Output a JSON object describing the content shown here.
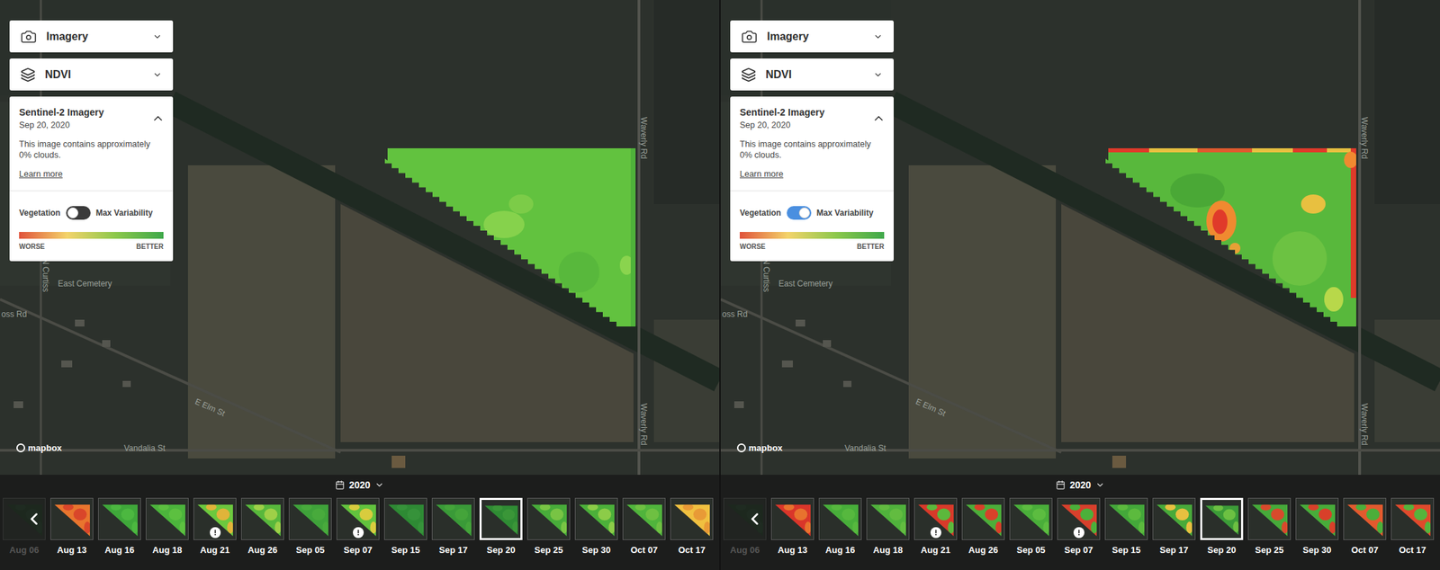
{
  "panels": [
    {
      "imagery_dropdown": {
        "label": "Imagery"
      },
      "layer_dropdown": {
        "label": "NDVI"
      },
      "card": {
        "title": "Sentinel-2 Imagery",
        "date": "Sep 20, 2020",
        "description": "This image contains approximately 0% clouds.",
        "link": "Learn more",
        "expanded": true,
        "toggle": {
          "left_label": "Vegetation",
          "right_label": "Max Variability",
          "on": false
        },
        "legend": {
          "low": "WORSE",
          "high": "BETTER"
        }
      },
      "map_labels": [
        {
          "text": "Waverly Rd",
          "kind": "vertical"
        },
        {
          "text": "Waverly Rd",
          "kind": "vertical"
        },
        {
          "text": "N Curtiss",
          "kind": "vertical"
        },
        {
          "text": "East Cemetery",
          "kind": "horizontal"
        },
        {
          "text": "oss Rd",
          "kind": "horizontal"
        },
        {
          "text": "E Elm St",
          "kind": "diagonal"
        },
        {
          "text": "Vandalia St",
          "kind": "horizontal"
        }
      ],
      "attribution": "mapbox",
      "timeline": {
        "year": "2020",
        "thumbnails": [
          {
            "label": "Aug 06",
            "selected": false,
            "faded": true,
            "warning": false,
            "color": "#1f3a22",
            "spot_color": "#24412a"
          },
          {
            "label": "Aug 13",
            "selected": false,
            "faded": false,
            "warning": false,
            "color": "#e8752e",
            "spot_color": "#d9462a"
          },
          {
            "label": "Aug 16",
            "selected": false,
            "faded": false,
            "warning": false,
            "color": "#3fa83a",
            "spot_color": "#4cb840"
          },
          {
            "label": "Aug 18",
            "selected": false,
            "faded": false,
            "warning": false,
            "color": "#4cb43c",
            "spot_color": "#5cc040"
          },
          {
            "label": "Aug 21",
            "selected": false,
            "faded": false,
            "warning": true,
            "color": "#6cc83e",
            "spot_color": "#e0b43a"
          },
          {
            "label": "Aug 26",
            "selected": false,
            "faded": false,
            "warning": false,
            "color": "#58b83c",
            "spot_color": "#9ed048"
          },
          {
            "label": "Sep 05",
            "selected": false,
            "faded": false,
            "warning": false,
            "color": "#3fa23a",
            "spot_color": "#48aa3c"
          },
          {
            "label": "Sep 07",
            "selected": false,
            "faded": false,
            "warning": true,
            "color": "#62c23e",
            "spot_color": "#d8cc3e"
          },
          {
            "label": "Sep 15",
            "selected": false,
            "faded": false,
            "warning": false,
            "color": "#2e8a34",
            "spot_color": "#36923a"
          },
          {
            "label": "Sep 17",
            "selected": false,
            "faded": false,
            "warning": false,
            "color": "#3a9a38",
            "spot_color": "#44a43a"
          },
          {
            "label": "Sep 20",
            "selected": true,
            "faded": false,
            "warning": false,
            "color": "#2f8c34",
            "spot_color": "#3a9638"
          },
          {
            "label": "Sep 25",
            "selected": false,
            "faded": false,
            "warning": false,
            "color": "#48ac3a",
            "spot_color": "#78c444"
          },
          {
            "label": "Sep 30",
            "selected": false,
            "faded": false,
            "warning": false,
            "color": "#4cb03a",
            "spot_color": "#8ccc48"
          },
          {
            "label": "Oct 07",
            "selected": false,
            "faded": false,
            "warning": false,
            "color": "#50b43c",
            "spot_color": "#6ec042"
          },
          {
            "label": "Oct 17",
            "selected": false,
            "faded": false,
            "warning": false,
            "color": "#f0c040",
            "spot_color": "#e89a36"
          }
        ]
      }
    },
    {
      "imagery_dropdown": {
        "label": "Imagery"
      },
      "layer_dropdown": {
        "label": "NDVI"
      },
      "card": {
        "title": "Sentinel-2 Imagery",
        "date": "Sep 20, 2020",
        "description": "This image contains approximately 0% clouds.",
        "link": "Learn more",
        "expanded": true,
        "toggle": {
          "left_label": "Vegetation",
          "right_label": "Max Variability",
          "on": true
        },
        "legend": {
          "low": "WORSE",
          "high": "BETTER"
        }
      },
      "map_labels": [
        {
          "text": "Waverly Rd",
          "kind": "vertical"
        },
        {
          "text": "Waverly Rd",
          "kind": "vertical"
        },
        {
          "text": "N Curtiss",
          "kind": "vertical"
        },
        {
          "text": "East Cemetery",
          "kind": "horizontal"
        },
        {
          "text": "oss Rd",
          "kind": "horizontal"
        },
        {
          "text": "E Elm St",
          "kind": "diagonal"
        },
        {
          "text": "Vandalia St",
          "kind": "horizontal"
        }
      ],
      "attribution": "mapbox",
      "timeline": {
        "year": "2020",
        "thumbnails": [
          {
            "label": "Aug 06",
            "selected": false,
            "faded": true,
            "warning": false,
            "color": "#1f3a22",
            "spot_color": "#24412a"
          },
          {
            "label": "Aug 13",
            "selected": false,
            "faded": false,
            "warning": false,
            "color": "#d9362a",
            "spot_color": "#e8722e"
          },
          {
            "label": "Aug 16",
            "selected": false,
            "faded": false,
            "warning": false,
            "color": "#48ae3a",
            "spot_color": "#56b83e"
          },
          {
            "label": "Aug 18",
            "selected": false,
            "faded": false,
            "warning": false,
            "color": "#50b23c",
            "spot_color": "#62bc40"
          },
          {
            "label": "Aug 21",
            "selected": false,
            "faded": false,
            "warning": true,
            "color": "#d83a2a",
            "spot_color": "#5cb83c"
          },
          {
            "label": "Aug 26",
            "selected": false,
            "faded": false,
            "warning": false,
            "color": "#4cae3a",
            "spot_color": "#d8402a"
          },
          {
            "label": "Sep 05",
            "selected": false,
            "faded": false,
            "warning": false,
            "color": "#4aae3a",
            "spot_color": "#5cbc40"
          },
          {
            "label": "Sep 07",
            "selected": false,
            "faded": false,
            "warning": true,
            "color": "#d8402c",
            "spot_color": "#4cb03a"
          },
          {
            "label": "Sep 15",
            "selected": false,
            "faded": false,
            "warning": false,
            "color": "#44a83a",
            "spot_color": "#5cba3e"
          },
          {
            "label": "Sep 17",
            "selected": false,
            "faded": false,
            "warning": false,
            "color": "#48aa3a",
            "spot_color": "#e8c040"
          },
          {
            "label": "Sep 20",
            "selected": true,
            "faded": false,
            "warning": false,
            "color": "#3c9c38",
            "spot_color": "#6cc042"
          },
          {
            "label": "Sep 25",
            "selected": false,
            "faded": false,
            "warning": false,
            "color": "#46aa3a",
            "spot_color": "#d84a2c"
          },
          {
            "label": "Sep 30",
            "selected": false,
            "faded": false,
            "warning": false,
            "color": "#48ac3a",
            "spot_color": "#d8402a"
          },
          {
            "label": "Oct 07",
            "selected": false,
            "faded": false,
            "warning": false,
            "color": "#e25a2e",
            "spot_color": "#4cae3a"
          },
          {
            "label": "Oct 17",
            "selected": false,
            "faded": false,
            "warning": false,
            "color": "#e04a2c",
            "spot_color": "#56b43c"
          }
        ]
      }
    }
  ]
}
